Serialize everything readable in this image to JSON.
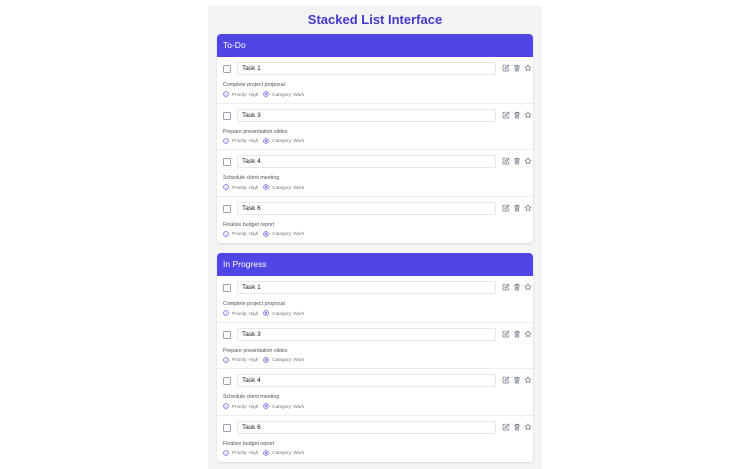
{
  "page": {
    "title": "Stacked List Interface"
  },
  "colors": {
    "accent": "#4f46e5",
    "title": "#4338ca",
    "panel_bg": "#f3f4f6"
  },
  "icons": {
    "edit": "edit-icon",
    "delete": "trash-icon",
    "favorite": "star-icon",
    "priority": "info-icon",
    "category": "tag-icon"
  },
  "sections": [
    {
      "title": "To-Do",
      "tasks": [
        {
          "name": "Task 1",
          "description": "Complete project proposal",
          "priority": "Priority: High",
          "category": "Category: Work"
        },
        {
          "name": "Task 3",
          "description": "Prepare presentation slides",
          "priority": "Priority: High",
          "category": "Category: Work"
        },
        {
          "name": "Task 4",
          "description": "Schedule client meeting",
          "priority": "Priority: High",
          "category": "Category: Work"
        },
        {
          "name": "Task 6",
          "description": "Finalize budget report",
          "priority": "Priority: High",
          "category": "Category: Work"
        }
      ]
    },
    {
      "title": "In Progress",
      "tasks": [
        {
          "name": "Task 1",
          "description": "Complete project proposal",
          "priority": "Priority: High",
          "category": "Category: Work"
        },
        {
          "name": "Task 3",
          "description": "Prepare presentation slides",
          "priority": "Priority: High",
          "category": "Category: Work"
        },
        {
          "name": "Task 4",
          "description": "Schedule client meeting",
          "priority": "Priority: High",
          "category": "Category: Work"
        },
        {
          "name": "Task 6",
          "description": "Finalize budget report",
          "priority": "Priority: High",
          "category": "Category: Work"
        }
      ]
    }
  ]
}
